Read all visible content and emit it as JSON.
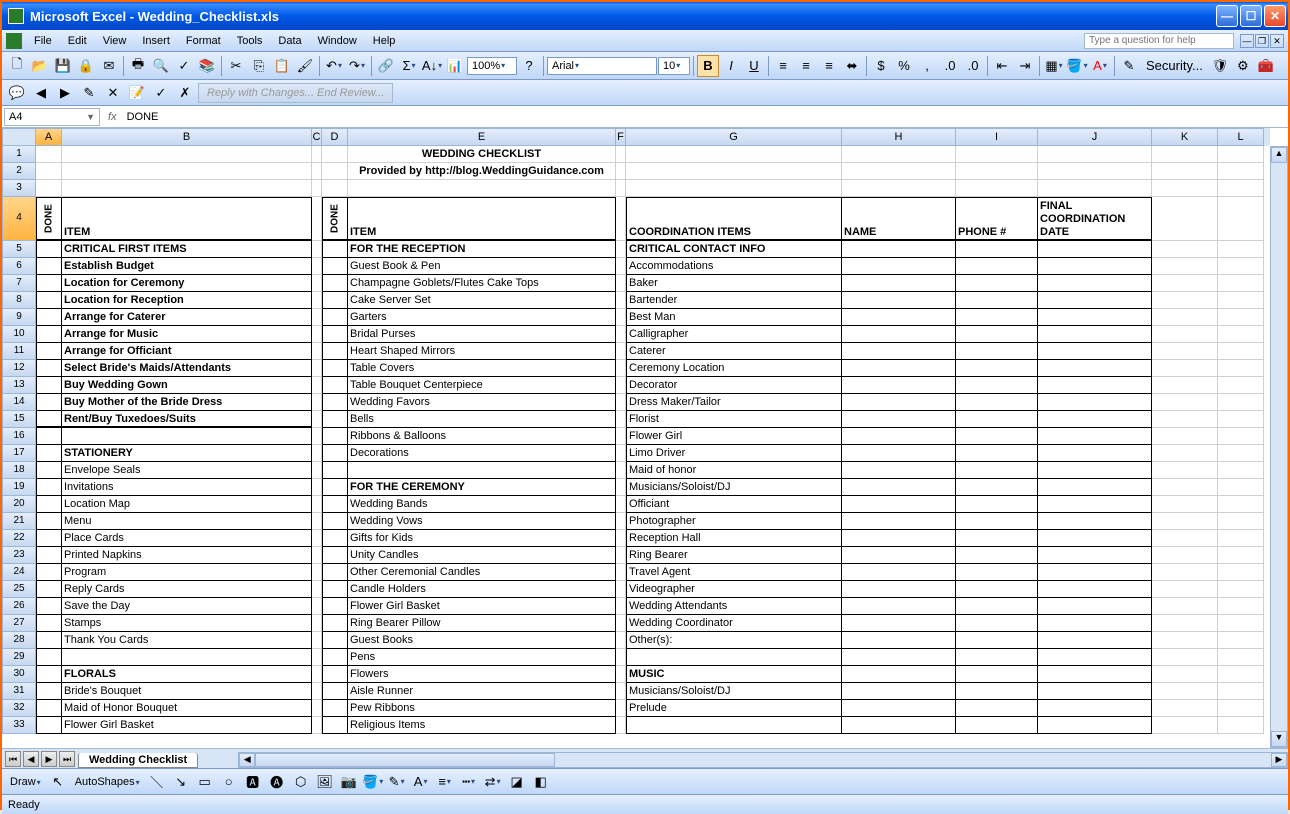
{
  "window": {
    "title": "Microsoft Excel - Wedding_Checklist.xls"
  },
  "menu": [
    "File",
    "Edit",
    "View",
    "Insert",
    "Format",
    "Tools",
    "Data",
    "Window",
    "Help"
  ],
  "help_placeholder": "Type a question for help",
  "toolbar": {
    "zoom": "100%",
    "font": "Arial",
    "size": "10",
    "security": "Security...",
    "review_disabled": "Reply with Changes... End Review..."
  },
  "formula": {
    "name_box": "A4",
    "fx": "fx",
    "value": "DONE"
  },
  "columns": [
    "A",
    "B",
    "C",
    "D",
    "E",
    "F",
    "G",
    "H",
    "I",
    "J",
    "K",
    "L"
  ],
  "rows_header": [
    "1",
    "2",
    "3",
    "4",
    "5",
    "6",
    "7",
    "8",
    "9",
    "10",
    "11",
    "12",
    "13",
    "14",
    "15",
    "16",
    "17",
    "18",
    "19",
    "20",
    "21",
    "22",
    "23",
    "24",
    "25",
    "26",
    "27",
    "28",
    "29",
    "30",
    "31",
    "32",
    "33"
  ],
  "sheet": {
    "title": "WEDDING CHECKLIST",
    "subtitle": "Provided by http://blog.WeddingGuidance.com",
    "headers": {
      "done": "DONE",
      "item": "ITEM",
      "coord": "COORDINATION ITEMS",
      "name": "NAME",
      "phone": "PHONE #",
      "final": "FINAL COORDINATION DATE"
    },
    "colB": [
      {
        "t": "CRITICAL FIRST ITEMS",
        "b": true
      },
      {
        "t": "Establish Budget",
        "b": true
      },
      {
        "t": "Location for Ceremony",
        "b": true
      },
      {
        "t": "Location for Reception",
        "b": true
      },
      {
        "t": "Arrange for Caterer",
        "b": true
      },
      {
        "t": "Arrange for Music",
        "b": true
      },
      {
        "t": "Arrange for Officiant",
        "b": true
      },
      {
        "t": "Select Bride's Maids/Attendants",
        "b": true
      },
      {
        "t": "Buy Wedding Gown",
        "b": true
      },
      {
        "t": "Buy Mother of the Bride Dress",
        "b": true
      },
      {
        "t": "Rent/Buy Tuxedoes/Suits",
        "b": true
      },
      {
        "t": "",
        "b": false
      },
      {
        "t": "  STATIONERY",
        "b": true
      },
      {
        "t": "Envelope Seals",
        "b": false
      },
      {
        "t": "Invitations",
        "b": false
      },
      {
        "t": "Location Map",
        "b": false
      },
      {
        "t": "Menu",
        "b": false
      },
      {
        "t": "Place Cards",
        "b": false
      },
      {
        "t": "Printed Napkins",
        "b": false
      },
      {
        "t": "Program",
        "b": false
      },
      {
        "t": "Reply Cards",
        "b": false
      },
      {
        "t": "Save the Day",
        "b": false
      },
      {
        "t": "Stamps",
        "b": false
      },
      {
        "t": "Thank You Cards",
        "b": false
      },
      {
        "t": "",
        "b": false
      },
      {
        "t": "FLORALS",
        "b": true
      },
      {
        "t": "Bride's Bouquet",
        "b": false
      },
      {
        "t": "Maid of Honor Bouquet",
        "b": false
      },
      {
        "t": "Flower Girl Basket",
        "b": false
      }
    ],
    "colE": [
      {
        "t": "FOR THE RECEPTION",
        "b": true
      },
      {
        "t": "Guest Book & Pen",
        "b": false
      },
      {
        "t": "Champagne Goblets/Flutes Cake Tops",
        "b": false
      },
      {
        "t": "Cake Server Set",
        "b": false
      },
      {
        "t": "Garters",
        "b": false
      },
      {
        "t": "Bridal Purses",
        "b": false
      },
      {
        "t": "Heart Shaped Mirrors",
        "b": false
      },
      {
        "t": "Table Covers",
        "b": false
      },
      {
        "t": "Table Bouquet Centerpiece",
        "b": false
      },
      {
        "t": "Wedding Favors",
        "b": false
      },
      {
        "t": "Bells",
        "b": false
      },
      {
        "t": "Ribbons & Balloons",
        "b": false
      },
      {
        "t": "Decorations",
        "b": false
      },
      {
        "t": "",
        "b": false
      },
      {
        "t": "FOR THE CEREMONY",
        "b": true
      },
      {
        "t": "Wedding Bands",
        "b": false
      },
      {
        "t": "Wedding Vows",
        "b": false
      },
      {
        "t": "Gifts for Kids",
        "b": false
      },
      {
        "t": "Unity Candles",
        "b": false
      },
      {
        "t": "Other Ceremonial Candles",
        "b": false
      },
      {
        "t": "Candle Holders",
        "b": false
      },
      {
        "t": "Flower Girl Basket",
        "b": false
      },
      {
        "t": "Ring Bearer Pillow",
        "b": false
      },
      {
        "t": "Guest Books",
        "b": false
      },
      {
        "t": "Pens",
        "b": false
      },
      {
        "t": "Flowers",
        "b": false
      },
      {
        "t": "Aisle Runner",
        "b": false
      },
      {
        "t": "Pew Ribbons",
        "b": false
      },
      {
        "t": "Religious Items",
        "b": false
      }
    ],
    "colG": [
      {
        "t": "CRITICAL CONTACT INFO",
        "b": true
      },
      {
        "t": "Accommodations",
        "b": false
      },
      {
        "t": "Baker",
        "b": false
      },
      {
        "t": "Bartender",
        "b": false
      },
      {
        "t": "Best Man",
        "b": false
      },
      {
        "t": "Calligrapher",
        "b": false
      },
      {
        "t": "Caterer",
        "b": false
      },
      {
        "t": "Ceremony Location",
        "b": false
      },
      {
        "t": "Decorator",
        "b": false
      },
      {
        "t": "Dress Maker/Tailor",
        "b": false
      },
      {
        "t": "Florist",
        "b": false
      },
      {
        "t": "Flower Girl",
        "b": false
      },
      {
        "t": "Limo Driver",
        "b": false
      },
      {
        "t": "Maid of honor",
        "b": false
      },
      {
        "t": "Musicians/Soloist/DJ",
        "b": false
      },
      {
        "t": "Officiant",
        "b": false
      },
      {
        "t": "Photographer",
        "b": false
      },
      {
        "t": "Reception Hall",
        "b": false
      },
      {
        "t": "Ring Bearer",
        "b": false
      },
      {
        "t": "Travel Agent",
        "b": false
      },
      {
        "t": "Videographer",
        "b": false
      },
      {
        "t": "Wedding Attendants",
        "b": false
      },
      {
        "t": "Wedding Coordinator",
        "b": false
      },
      {
        "t": "Other(s):",
        "b": false
      },
      {
        "t": "",
        "b": false
      },
      {
        "t": "MUSIC",
        "b": true
      },
      {
        "t": "Musicians/Soloist/DJ",
        "b": false
      },
      {
        "t": "Prelude",
        "b": false
      }
    ]
  },
  "tabs": {
    "active": "Wedding Checklist"
  },
  "draw": {
    "label": "Draw",
    "autoshapes": "AutoShapes"
  },
  "status": "Ready"
}
